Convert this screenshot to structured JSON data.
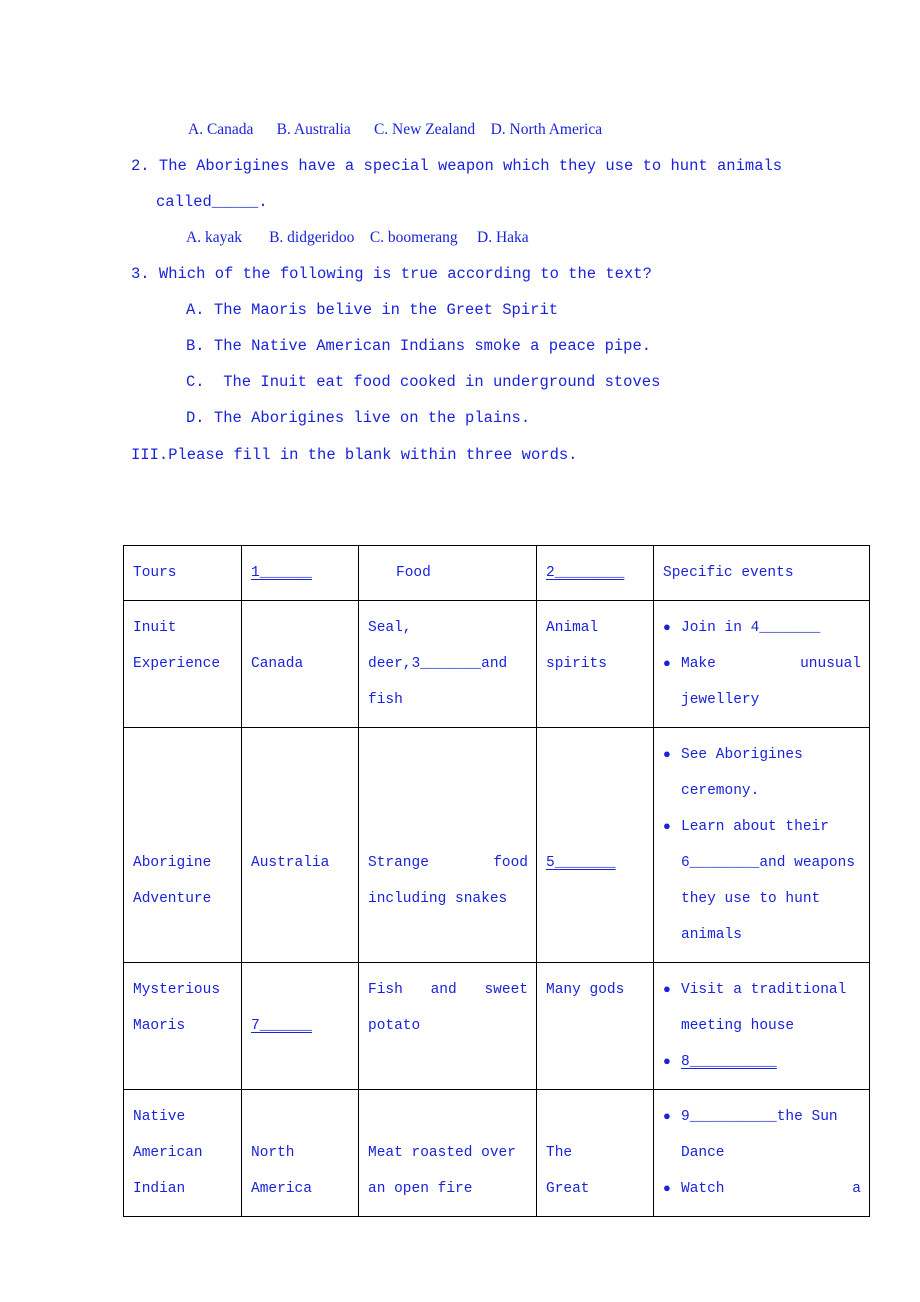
{
  "questions": [
    {
      "id": "q1-options",
      "type": "options",
      "text": "A. Canada      B. Australia      C. New Zealand    D. North America"
    },
    {
      "id": "q2-stem-line1",
      "type": "stem",
      "text": "2. The Aborigines have a special weapon which they use to hunt animals"
    },
    {
      "id": "q2-stem-line2",
      "type": "stem-cont",
      "text": "called_____."
    },
    {
      "id": "q2-options",
      "type": "options",
      "text": "A. kayak       B. didgeridoo    C. boomerang     D. Haka"
    },
    {
      "id": "q3-stem",
      "type": "stem",
      "text": "3. Which of the following is true according to the text?"
    },
    {
      "id": "q3-option-a",
      "type": "option",
      "text": "A. The Maoris belive in the Greet Spirit"
    },
    {
      "id": "q3-option-b",
      "type": "option",
      "text": "B. The Native American Indians smoke a peace pipe."
    },
    {
      "id": "q3-option-c",
      "type": "option",
      "text": "C.  The Inuit eat food cooked in underground stoves"
    },
    {
      "id": "q3-option-d",
      "type": "option",
      "text": "D. The Aborigines live on the plains."
    }
  ],
  "section_heading": "III.Please fill in the blank within three words.",
  "table": {
    "headers": [
      "Tours",
      "1______",
      "Food",
      "2________",
      "Specific events"
    ],
    "rows": [
      {
        "tour_lines": [
          "Inuit",
          "Experience"
        ],
        "place": "Canada",
        "food_lines": [
          "Seal,",
          "deer,3_______and",
          "fish"
        ],
        "belief_lines": [
          "Animal",
          "spirits"
        ],
        "events": [
          "Join in 4_______",
          "Make    unusual jewellery"
        ]
      },
      {
        "tour_lines": [
          "Aborigine",
          "Adventure"
        ],
        "place": "Australia",
        "food_lines": [
          "Strange      food",
          "including snakes"
        ],
        "belief_lines": [
          "5_______"
        ],
        "events": [
          "See    Aborigines ceremony.",
          "Learn about their 6________and weapons they use to hunt animals"
        ]
      },
      {
        "tour_lines": [
          "Mysterious",
          "Maoris"
        ],
        "place": "7______",
        "food_lines": [
          "Fish   and   sweet",
          "potato"
        ],
        "belief_lines": [
          "Many gods"
        ],
        "events": [
          "Visit          a traditional meeting house",
          "8__________"
        ]
      },
      {
        "tour_lines": [
          "Native",
          "American",
          "Indian"
        ],
        "place_lines": [
          "North",
          "America"
        ],
        "food_lines": [
          "Meat roasted over",
          "an open fire"
        ],
        "belief_lines": [
          "The",
          "Great"
        ],
        "events": [
          "9__________the Sun Dance",
          "Watch          a"
        ]
      }
    ]
  },
  "bullet_glyph": "●"
}
